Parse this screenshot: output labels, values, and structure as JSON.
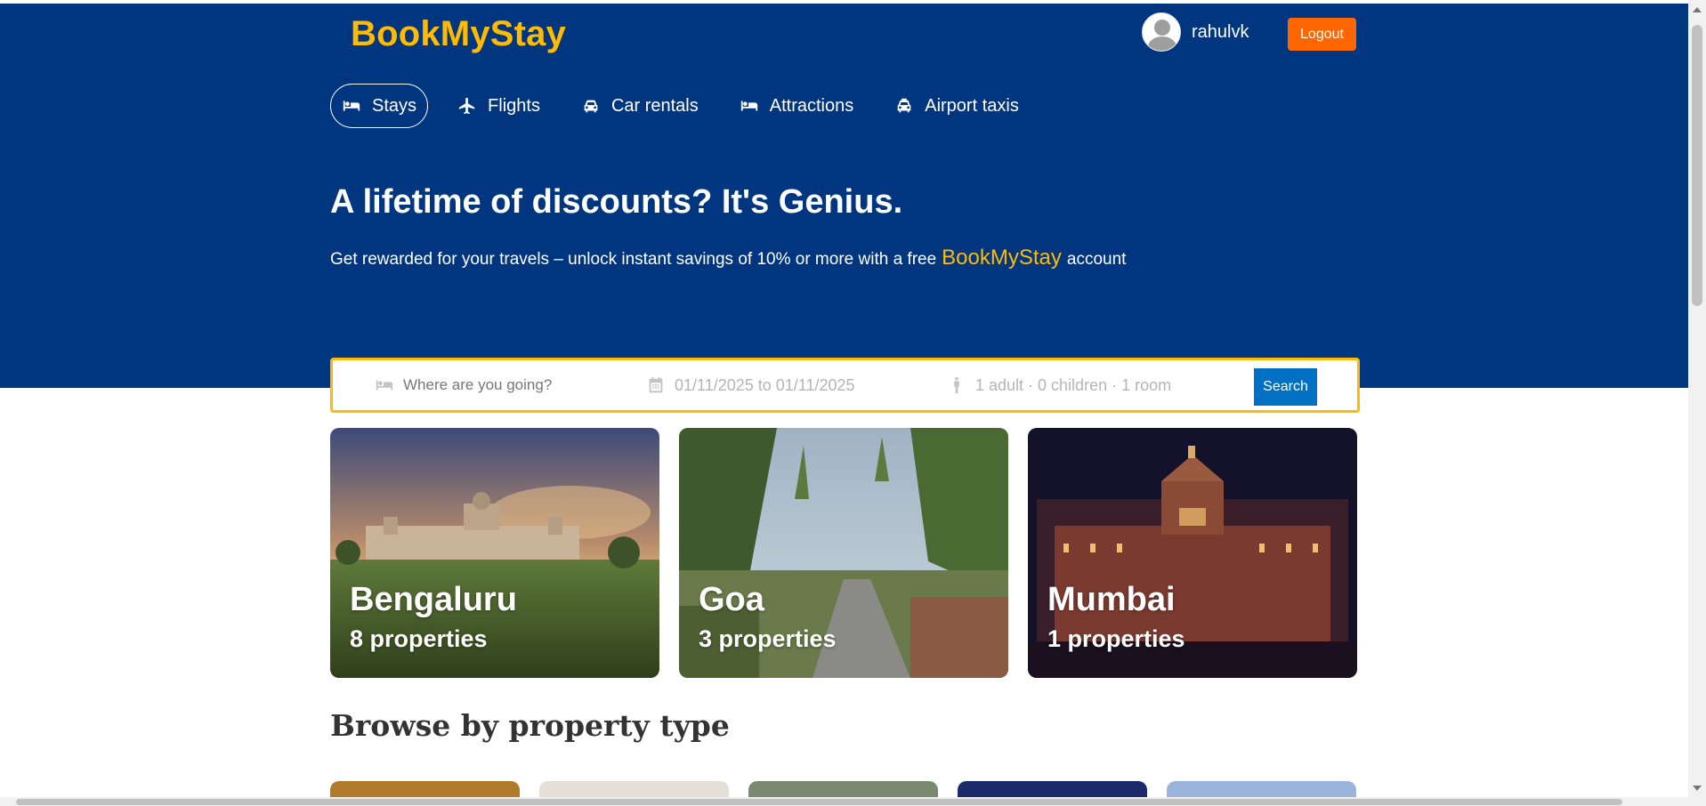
{
  "brand": {
    "name": "BookMyStay",
    "color": "#febb02"
  },
  "user": {
    "username": "rahulvk",
    "avatar_icon": "user-avatar-icon"
  },
  "logout_label": "Logout",
  "nav": {
    "items": [
      {
        "label": "Stays",
        "icon": "bed-icon",
        "active": true
      },
      {
        "label": "Flights",
        "icon": "plane-icon",
        "active": false
      },
      {
        "label": "Car rentals",
        "icon": "car-icon",
        "active": false
      },
      {
        "label": "Attractions",
        "icon": "bed-icon",
        "active": false
      },
      {
        "label": "Airport taxis",
        "icon": "taxi-icon",
        "active": false
      }
    ]
  },
  "hero": {
    "title": "A lifetime of discounts? It's Genius.",
    "subtitle_before": "Get rewarded for your travels – unlock instant savings of 10% or more with a free",
    "subtitle_brand": "BookMyStay",
    "subtitle_after": "account"
  },
  "search": {
    "destination_placeholder": "Where are you going?",
    "dates": "01/11/2025 to 01/11/2025",
    "guests": "1 adult · 0 children · 1 room",
    "button_label": "Search"
  },
  "cities": [
    {
      "name": "Bengaluru",
      "properties": "8 properties"
    },
    {
      "name": "Goa",
      "properties": "3 properties"
    },
    {
      "name": "Mumbai",
      "properties": "1 properties"
    }
  ],
  "browse": {
    "title": "Browse by property type"
  },
  "colors": {
    "header_bg": "#003580",
    "accent": "#febb02",
    "logout": "#ff6600",
    "search_button": "#0071c2"
  }
}
